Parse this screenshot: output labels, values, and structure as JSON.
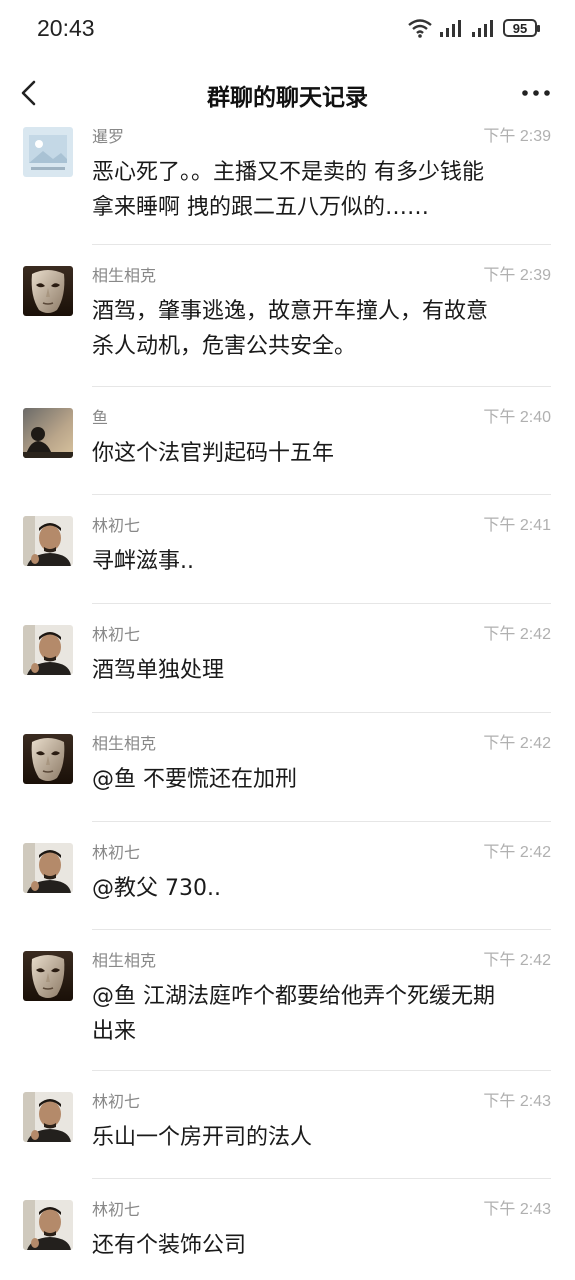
{
  "status_bar": {
    "time": "20:43",
    "battery": "95"
  },
  "nav": {
    "title": "群聊的聊天记录"
  },
  "messages": [
    {
      "sender": "暹罗",
      "time": "下午 2:39",
      "text": "恶心死了。。主播又不是卖的 有多少钱能\n拿来睡啊 拽的跟二五八万似的……",
      "avatar": "picture-avatar"
    },
    {
      "sender": "相生相克",
      "time": "下午 2:39",
      "text": "酒驾，肇事逃逸，故意开车撞人，有故意\n杀人动机，危害公共安全。",
      "avatar": "mask-avatar"
    },
    {
      "sender": "鱼",
      "time": "下午 2:40",
      "text": "你这个法官判起码十五年",
      "avatar": "silhouette-avatar"
    },
    {
      "sender": "林初七",
      "time": "下午 2:41",
      "text": "寻衅滋事..",
      "avatar": "man-avatar"
    },
    {
      "sender": "林初七",
      "time": "下午 2:42",
      "text": "酒驾单独处理",
      "avatar": "man-avatar"
    },
    {
      "sender": "相生相克",
      "time": "下午 2:42",
      "text": "@鱼 不要慌还在加刑",
      "avatar": "mask-avatar"
    },
    {
      "sender": "林初七",
      "time": "下午 2:42",
      "text": "@教父 730..",
      "avatar": "man-avatar"
    },
    {
      "sender": "相生相克",
      "time": "下午 2:42",
      "text": "@鱼 江湖法庭咋个都要给他弄个死缓无期\n出来",
      "avatar": "mask-avatar"
    },
    {
      "sender": "林初七",
      "time": "下午 2:43",
      "text": "乐山一个房开司的法人",
      "avatar": "man-avatar"
    },
    {
      "sender": "林初七",
      "time": "下午 2:43",
      "text": "还有个装饰公司",
      "avatar": "man-avatar"
    }
  ]
}
